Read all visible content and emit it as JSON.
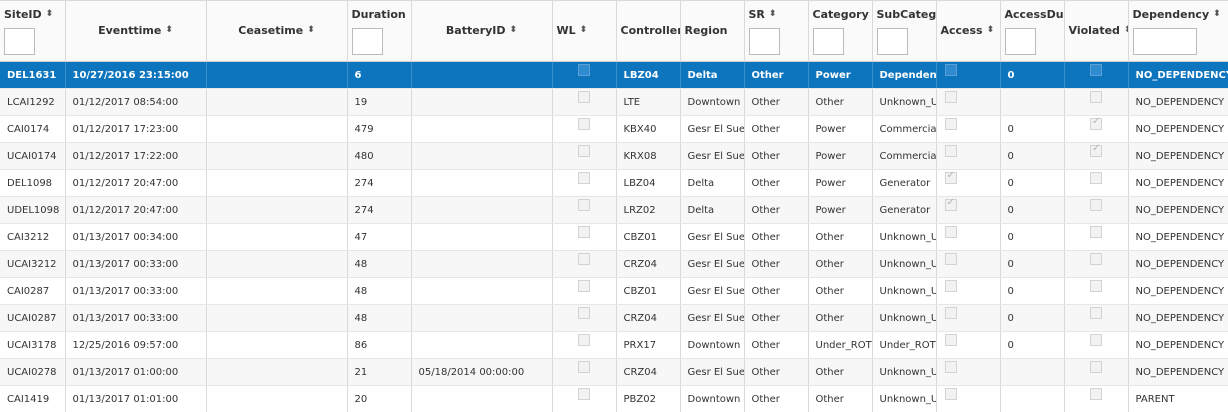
{
  "columns": [
    {
      "label": "SiteID",
      "sortable": true,
      "filter": true
    },
    {
      "label": "Eventtime",
      "sortable": true,
      "filter": false
    },
    {
      "label": "Ceasetime",
      "sortable": true,
      "filter": false
    },
    {
      "label": "Duration",
      "sortable": true,
      "filter": true
    },
    {
      "label": "BatteryID",
      "sortable": true,
      "filter": false
    },
    {
      "label": "WL",
      "sortable": true,
      "filter": false
    },
    {
      "label": "Controller",
      "sortable": false,
      "filter": false
    },
    {
      "label": "Region",
      "sortable": false,
      "filter": false
    },
    {
      "label": "SR",
      "sortable": true,
      "filter": true
    },
    {
      "label": "Category",
      "sortable": false,
      "filter": true
    },
    {
      "label": "SubCategory",
      "sortable": false,
      "filter": true
    },
    {
      "label": "Access",
      "sortable": true,
      "filter": false
    },
    {
      "label": "AccessDuration",
      "sortable": false,
      "filter": true
    },
    {
      "label": "Violated",
      "sortable": true,
      "filter": false
    },
    {
      "label": "Dependency",
      "sortable": true,
      "filter": true
    }
  ],
  "selected_row": 0,
  "rows": [
    {
      "site": "DEL1631",
      "event": "10/27/2016 23:15:00",
      "cease": "",
      "duration": "6",
      "battery": "",
      "wl": false,
      "controller": "LBZ04",
      "region": "Delta",
      "sr": "Other",
      "category": "Power",
      "subcategory": "Dependency",
      "access": false,
      "access_duration": "0",
      "violated": false,
      "dependency": "NO_DEPENDENCY"
    },
    {
      "site": "LCAI1292",
      "event": "01/12/2017 08:54:00",
      "cease": "",
      "duration": "19",
      "battery": "",
      "wl": false,
      "controller": "LTE",
      "region": "Downtown",
      "sr": "Other",
      "category": "Other",
      "subcategory": "Unknown_Unknown",
      "access": false,
      "access_duration": "",
      "violated": false,
      "dependency": "NO_DEPENDENCY"
    },
    {
      "site": "CAI0174",
      "event": "01/12/2017 17:23:00",
      "cease": "",
      "duration": "479",
      "battery": "",
      "wl": false,
      "controller": "KBX40",
      "region": "Gesr El Suez",
      "sr": "Other",
      "category": "Power",
      "subcategory": "Commercial",
      "access": false,
      "access_duration": "0",
      "violated": true,
      "dependency": "NO_DEPENDENCY"
    },
    {
      "site": "UCAI0174",
      "event": "01/12/2017 17:22:00",
      "cease": "",
      "duration": "480",
      "battery": "",
      "wl": false,
      "controller": "KRX08",
      "region": "Gesr El Suez",
      "sr": "Other",
      "category": "Power",
      "subcategory": "Commercial",
      "access": false,
      "access_duration": "0",
      "violated": true,
      "dependency": "NO_DEPENDENCY"
    },
    {
      "site": "DEL1098",
      "event": "01/12/2017 20:47:00",
      "cease": "",
      "duration": "274",
      "battery": "",
      "wl": false,
      "controller": "LBZ04",
      "region": "Delta",
      "sr": "Other",
      "category": "Power",
      "subcategory": "Generator",
      "access": true,
      "access_duration": "0",
      "violated": false,
      "dependency": "NO_DEPENDENCY"
    },
    {
      "site": "UDEL1098",
      "event": "01/12/2017 20:47:00",
      "cease": "",
      "duration": "274",
      "battery": "",
      "wl": false,
      "controller": "LRZ02",
      "region": "Delta",
      "sr": "Other",
      "category": "Power",
      "subcategory": "Generator",
      "access": true,
      "access_duration": "0",
      "violated": false,
      "dependency": "NO_DEPENDENCY"
    },
    {
      "site": "CAI3212",
      "event": "01/13/2017 00:34:00",
      "cease": "",
      "duration": "47",
      "battery": "",
      "wl": false,
      "controller": "CBZ01",
      "region": "Gesr El Suez",
      "sr": "Other",
      "category": "Other",
      "subcategory": "Unknown_Unknown",
      "access": false,
      "access_duration": "0",
      "violated": false,
      "dependency": "NO_DEPENDENCY"
    },
    {
      "site": "UCAI3212",
      "event": "01/13/2017 00:33:00",
      "cease": "",
      "duration": "48",
      "battery": "",
      "wl": false,
      "controller": "CRZ04",
      "region": "Gesr El Suez",
      "sr": "Other",
      "category": "Other",
      "subcategory": "Unknown_Unknown",
      "access": false,
      "access_duration": "0",
      "violated": false,
      "dependency": "NO_DEPENDENCY"
    },
    {
      "site": "CAI0287",
      "event": "01/13/2017 00:33:00",
      "cease": "",
      "duration": "48",
      "battery": "",
      "wl": false,
      "controller": "CBZ01",
      "region": "Gesr El Suez",
      "sr": "Other",
      "category": "Other",
      "subcategory": "Unknown_Unknown",
      "access": false,
      "access_duration": "0",
      "violated": false,
      "dependency": "NO_DEPENDENCY"
    },
    {
      "site": "UCAI0287",
      "event": "01/13/2017 00:33:00",
      "cease": "",
      "duration": "48",
      "battery": "",
      "wl": false,
      "controller": "CRZ04",
      "region": "Gesr El Suez",
      "sr": "Other",
      "category": "Other",
      "subcategory": "Unknown_Unknown",
      "access": false,
      "access_duration": "0",
      "violated": false,
      "dependency": "NO_DEPENDENCY"
    },
    {
      "site": "UCAI3178",
      "event": "12/25/2016 09:57:00",
      "cease": "",
      "duration": "86",
      "battery": "",
      "wl": false,
      "controller": "PRX17",
      "region": "Downtown",
      "sr": "Other",
      "category": "Under_ROT",
      "subcategory": "Under_ROT",
      "access": false,
      "access_duration": "0",
      "violated": false,
      "dependency": "NO_DEPENDENCY"
    },
    {
      "site": "UCAI0278",
      "event": "01/13/2017 01:00:00",
      "cease": "",
      "duration": "21",
      "battery": "05/18/2014 00:00:00",
      "wl": false,
      "controller": "CRZ04",
      "region": "Gesr El Suez",
      "sr": "Other",
      "category": "Other",
      "subcategory": "Unknown_Unknown",
      "access": false,
      "access_duration": "",
      "violated": false,
      "dependency": "NO_DEPENDENCY"
    },
    {
      "site": "CAI1419",
      "event": "01/13/2017 01:01:00",
      "cease": "",
      "duration": "20",
      "battery": "",
      "wl": false,
      "controller": "PBZ02",
      "region": "Downtown",
      "sr": "Other",
      "category": "Other",
      "subcategory": "Unknown_Unknown",
      "access": false,
      "access_duration": "",
      "violated": false,
      "dependency": "PARENT"
    }
  ]
}
